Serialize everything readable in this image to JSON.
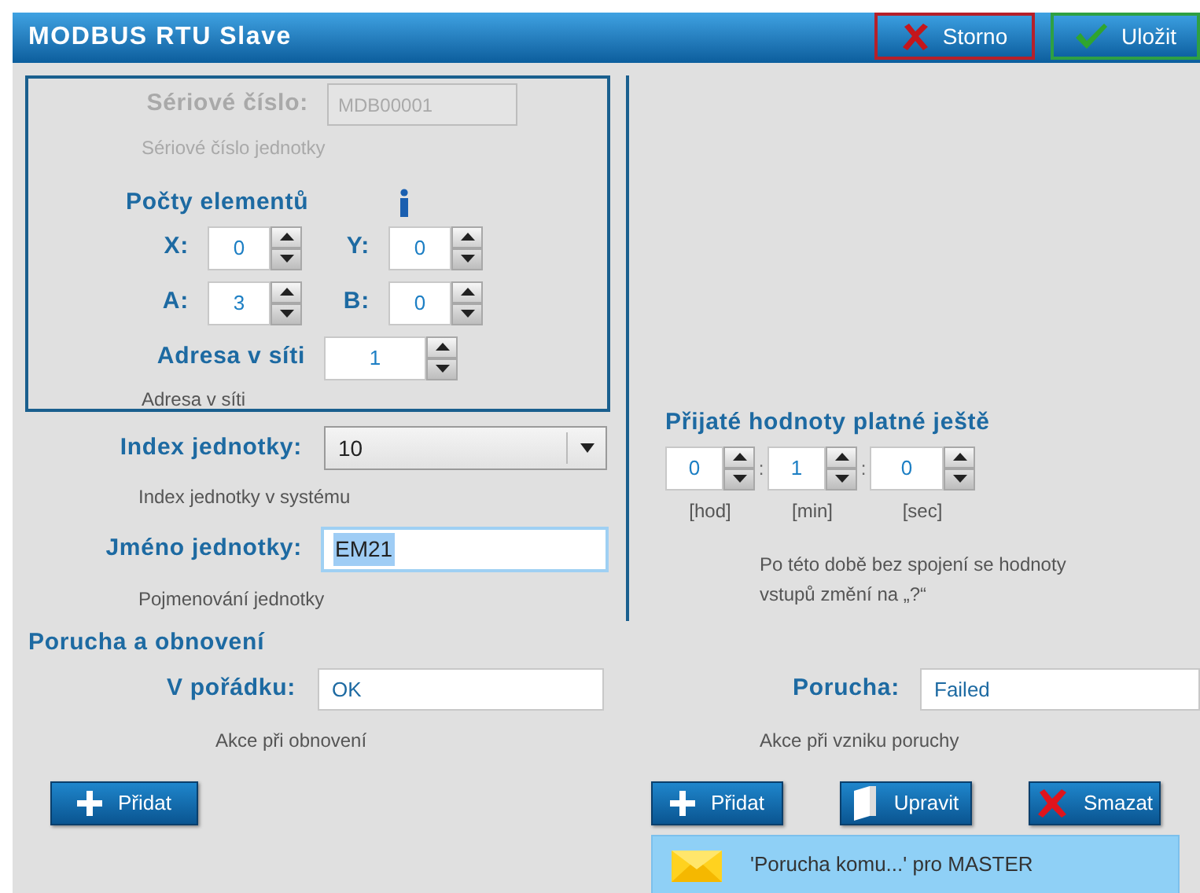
{
  "window": {
    "title": "MODBUS RTU Slave"
  },
  "header_buttons": [
    {
      "label": "Storno",
      "kind": "cancel"
    },
    {
      "label": "Uložit",
      "kind": "save"
    }
  ],
  "serial": {
    "label": "Sériové číslo:",
    "value": "MDB00001",
    "hint": "Sériové číslo jednotky",
    "disabled": true
  },
  "element_counts": {
    "title": "Počty elementů",
    "rows": [
      [
        {
          "label": "X:",
          "value": "0"
        },
        {
          "label": "Y:",
          "value": "0"
        }
      ],
      [
        {
          "label": "A:",
          "value": "3"
        },
        {
          "label": "B:",
          "value": "0"
        }
      ]
    ]
  },
  "address": {
    "label": "Adresa v síti",
    "value": "1",
    "hint": "Adresa v síti"
  },
  "unit_index": {
    "label": "Index jednotky:",
    "value": "10",
    "hint": "Index jednotky v systému"
  },
  "unit_name": {
    "label": "Jméno jednotky:",
    "value": "EM21",
    "hint": "Pojmenování jednotky",
    "focused": true
  },
  "validity": {
    "title": "Přijaté hodnoty platné ještě",
    "fields": [
      {
        "value": "0",
        "unit": "[hod]"
      },
      {
        "value": "1",
        "unit": "[min]"
      },
      {
        "value": "0",
        "unit": "[sec]"
      }
    ],
    "separators": [
      ":",
      ":"
    ],
    "note": "Po této době bez spojení se hodnoty vstupů změní na „?“"
  },
  "fault": {
    "title": "Porucha a obnovení",
    "ok": {
      "label": "V pořádku:",
      "value": "OK",
      "hint": "Akce při obnovení",
      "buttons": [
        {
          "label": "Přidat",
          "kind": "add"
        }
      ]
    },
    "failure": {
      "label": "Porucha:",
      "value": "Failed",
      "hint": "Akce při vzniku poruchy",
      "buttons": [
        {
          "label": "Přidat",
          "kind": "add"
        },
        {
          "label": "Upravit",
          "kind": "edit"
        },
        {
          "label": "Smazat",
          "kind": "delete"
        }
      ],
      "actions": [
        {
          "text": "'Porucha komu...' pro MASTER",
          "selected": true
        }
      ]
    }
  }
}
